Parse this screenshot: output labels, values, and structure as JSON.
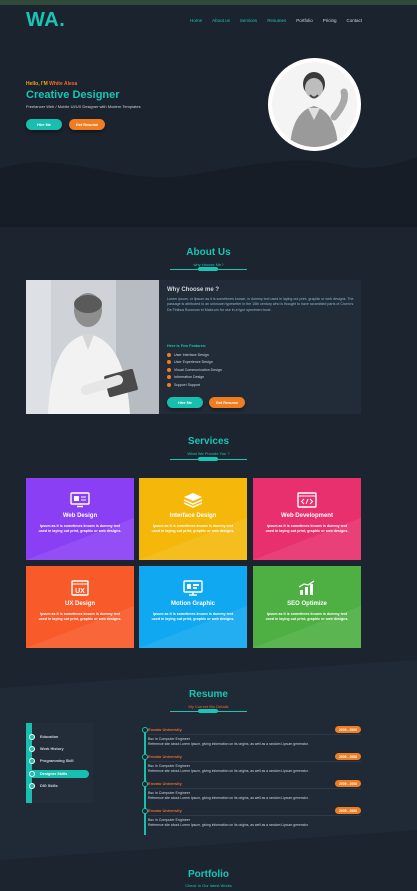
{
  "header": {
    "logo": "WA.",
    "nav": [
      {
        "label": "Home"
      },
      {
        "label": "About us"
      },
      {
        "label": "Services"
      },
      {
        "label": "Resumes"
      },
      {
        "label": "Portfolio"
      },
      {
        "label": "Pricing"
      },
      {
        "label": "Contact"
      }
    ]
  },
  "hero": {
    "greeting_prefix": "Hello, I'M",
    "greeting_name": "White Alexa",
    "title": "Creative Designer",
    "subtitle": "Freelancer Web / Mobile UI/UX Designer with Modern Templates",
    "hire_label": "Hire Me",
    "resume_label": "Get Resume"
  },
  "about": {
    "title": "About Us",
    "subtitle": "why choose Me?",
    "heading": "Why Choose me ?",
    "paragraph": "Lorem ipsum, or lipsum as it is sometimes known, is dummy text used in laying out print, graphic or web designs. The passage is attributed to an unknown typesetter in the 15th century who is thought to have scrambled parts of Cicero's De Finibus Bonorum et Malorum for use in a type specimen book.",
    "features_title": "Here Is Few Features:",
    "features": [
      "User Interface Design",
      "User Experience Design",
      "Visual Communication Design",
      "Information Design",
      "Support Support"
    ],
    "hire_label": "Hire Me",
    "resume_label": "Get Resume"
  },
  "services": {
    "title": "Services",
    "subtitle": "What We Provide You ?",
    "items": [
      {
        "title": "Web Design",
        "text": "Ipsum as it is sometimes known is dummy text used in laying out print, graphic or web designs.",
        "color": "#8a3ff5",
        "icon": "web-design-icon"
      },
      {
        "title": "Interface Design",
        "text": "Ipsum as it is sometimes known is dummy text used in laying out print, graphic or web designs.",
        "color": "#f5b80a",
        "icon": "layers-icon"
      },
      {
        "title": "Web Development",
        "text": "Ipsum as it is sometimes known is dummy text used in laying out print, graphic or web designs.",
        "color": "#e8306e",
        "icon": "code-window-icon"
      },
      {
        "title": "UX Design",
        "text": "Ipsum as it is sometimes known is dummy text used in laying out print, graphic or web designs.",
        "color": "#f85a2a",
        "icon": "ux-icon"
      },
      {
        "title": "Motion Graphic",
        "text": "Ipsum as it is sometimes known is dummy text used in laying out print, graphic or web designs.",
        "color": "#10a8f0",
        "icon": "monitor-icon"
      },
      {
        "title": "SEO Optimize",
        "text": "Ipsum as it is sometimes known is dummy text used in laying out print, graphic or web designs.",
        "color": "#4eb043",
        "icon": "bar-chart-icon"
      }
    ]
  },
  "resume": {
    "title": "Resume",
    "subtitle": "My Current Bio Details",
    "tabs": [
      {
        "label": "Education",
        "active": false
      },
      {
        "label": "Work History",
        "active": false
      },
      {
        "label": "Programming Skill",
        "active": false
      },
      {
        "label": "Designer Skills",
        "active": true
      },
      {
        "label": "DIG Skills",
        "active": false
      }
    ],
    "entries": [
      {
        "school": "Envato University",
        "date": "2009 - 2008",
        "degree": "Bsc in Computer Engineer",
        "desc": "Reference site about Lorem Ipsum, giving information on its origins, as well as a random Lipsum generator."
      },
      {
        "school": "Envato University",
        "date": "2009 - 2008",
        "degree": "Bsc in Computer Engineer",
        "desc": "Reference site about Lorem Ipsum, giving information on its origins, as well as a random Lipsum generator."
      },
      {
        "school": "Envato University",
        "date": "2009 - 2008",
        "degree": "Bsc in Computer Engineer",
        "desc": "Reference site about Lorem Ipsum, giving information on its origins, as well as a random Lipsum generator."
      },
      {
        "school": "Envato University",
        "date": "2009 - 2008",
        "degree": "Bsc in Computer Engineer",
        "desc": "Reference site about Lorem Ipsum, giving information on its origins, as well as a random Lipsum generator."
      }
    ]
  },
  "portfolio": {
    "title": "Portfolio",
    "subtitle": "Check In Our latest Works"
  },
  "colors": {
    "accent": "#19c5b4",
    "orange": "#f07d22",
    "background": "#1c2430"
  }
}
